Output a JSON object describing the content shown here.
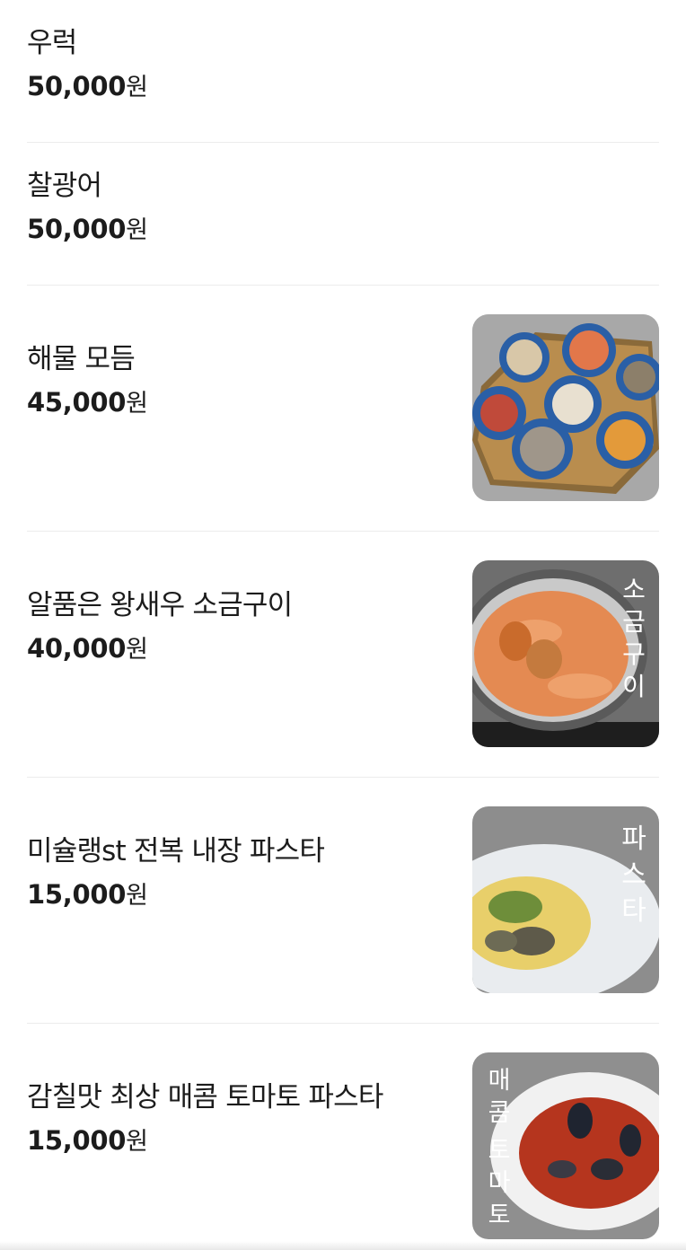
{
  "menu": {
    "items": [
      {
        "name": "우럭",
        "price": "50,000",
        "unit": "원"
      },
      {
        "name": "찰광어",
        "price": "50,000",
        "unit": "원"
      },
      {
        "name": "해물 모듬",
        "price": "45,000",
        "unit": "원",
        "image": "seafood-platter"
      },
      {
        "name": "알품은 왕새우 소금구이",
        "price": "40,000",
        "unit": "원",
        "image": "salt-grilled-shrimp",
        "overlay": "소금구이"
      },
      {
        "name": "미슐랭st 전복 내장 파스타",
        "price": "15,000",
        "unit": "원",
        "image": "abalone-pasta",
        "overlay": "파스타"
      },
      {
        "name": "감칠맛 최상 매콤 토마토 파스타",
        "price": "15,000",
        "unit": "원",
        "image": "spicy-tomato-pasta",
        "overlay": "매콤토마토"
      }
    ]
  }
}
